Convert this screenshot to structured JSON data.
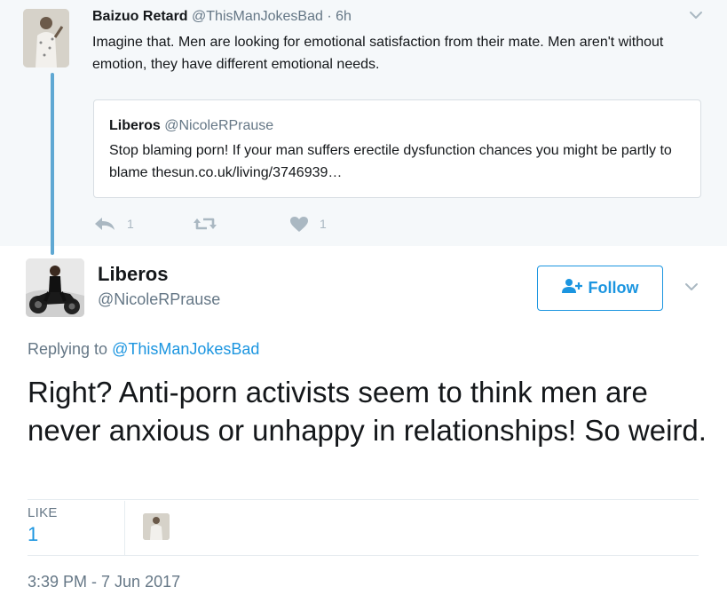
{
  "parent_tweet": {
    "name": "Baizuo Retard",
    "handle": "@ThisManJokesBad",
    "separator": "·",
    "age": "6h",
    "text": "Imagine that. Men are looking for emotional satisfaction from their mate. Men aren't without emotion, they have different emotional needs.",
    "quote": {
      "name": "Liberos",
      "handle": "@NicoleRPrause",
      "text": "Stop blaming porn! If your man suffers erectile dysfunction chances you might be partly to blame thesun.co.uk/living/3746939…"
    },
    "actions": {
      "reply_count": "1",
      "retweet_count": "",
      "like_count": "1"
    }
  },
  "main_tweet": {
    "name": "Liberos",
    "handle": "@NicoleRPrause",
    "follow_label": "Follow",
    "replying_prefix": "Replying to",
    "replying_to": "@ThisManJokesBad",
    "text": "Right? Anti-porn activists seem to think men are never anxious or unhappy in relationships! So weird.",
    "likes_label": "LIKE",
    "likes_count": "1",
    "timestamp": "3:39 PM - 7 Jun 2017"
  },
  "colors": {
    "accent": "#1b95e0",
    "muted": "#657786",
    "icon_gray": "#aab8c2",
    "thread_line": "#5fa8d3",
    "parent_bg": "#f5f8fa"
  },
  "icons": [
    "chevron-down-icon",
    "reply-icon",
    "retweet-icon",
    "heart-icon",
    "add-user-icon"
  ]
}
